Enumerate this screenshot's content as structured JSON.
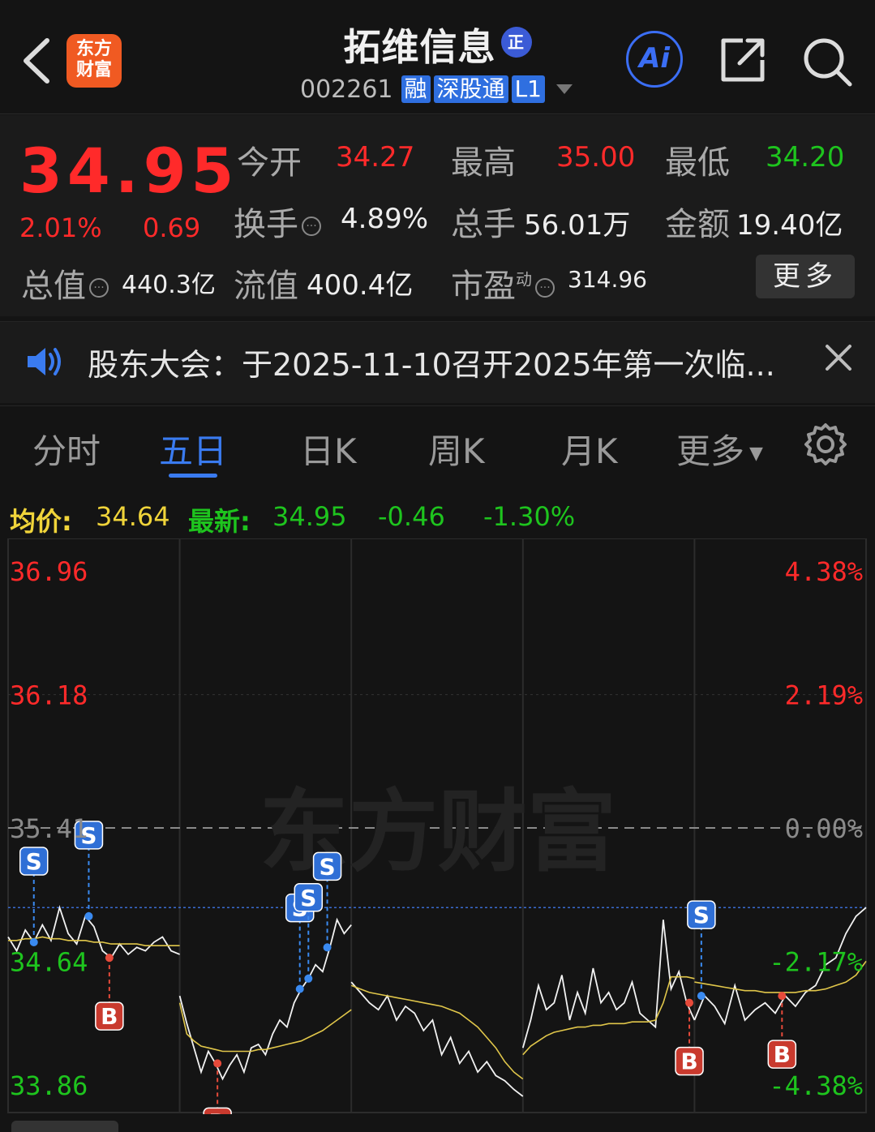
{
  "header": {
    "stock_name": "拓维信息",
    "zheng_badge": "正",
    "code": "002261",
    "tags": [
      "融",
      "深股通",
      "L1"
    ],
    "logo_text_line1": "东方",
    "logo_text_line2": "财富",
    "ai_label": "Ai"
  },
  "quote": {
    "price": "34.95",
    "change_pct": "2.01%",
    "change_amt": "0.69",
    "open_label": "今开",
    "open": "34.27",
    "high_label": "最高",
    "high": "35.00",
    "low_label": "最低",
    "low": "34.20",
    "turnover_label": "换手",
    "turnover": "4.89%",
    "volume_label": "总手",
    "volume": "56.01万",
    "amount_label": "金额",
    "amount": "19.40亿",
    "mktcap_label": "总值",
    "mktcap": "440.3亿",
    "float_label": "流值",
    "float_cap": "400.4亿",
    "pe_label": "市盈",
    "pe_sup": "动",
    "pe": "314.96",
    "more": "更多"
  },
  "notice": {
    "text": "股东大会：于2025-11-10召开2025年第一次临..."
  },
  "tabs": [
    "分时",
    "五日",
    "日K",
    "周K",
    "月K",
    "更多"
  ],
  "active_tab": 1,
  "infobar": {
    "avg_label": "均价:",
    "avg": "34.64",
    "latest_label": "最新:",
    "latest": "34.95",
    "chg": "-0.46",
    "chg_pct": "-1.30%"
  },
  "chart_data": {
    "type": "line",
    "days": 5,
    "y_left_ticks": [
      "36.96",
      "36.18",
      "35.41",
      "34.64",
      "33.86"
    ],
    "y_right_ticks": [
      "4.38%",
      "2.19%",
      "0.00%",
      "-2.17%",
      "-4.38%"
    ],
    "ylim": [
      33.86,
      36.96
    ],
    "base_price": 35.41,
    "watermark": "东方财富",
    "series": [
      {
        "values": [
          34.78,
          34.7,
          34.82,
          34.75,
          34.85,
          34.76,
          34.95,
          34.8,
          34.74,
          34.9,
          34.84,
          34.7,
          34.66,
          34.74,
          34.68,
          34.72,
          34.7,
          34.75,
          34.78,
          34.7,
          34.68,
          34.44,
          34.28,
          34.14,
          34.0,
          34.12,
          34.05,
          33.96,
          34.04,
          34.1,
          34.0,
          34.14,
          34.16,
          34.1,
          34.22,
          34.3,
          34.26,
          34.4,
          34.48,
          34.54,
          34.62,
          34.58,
          34.72,
          34.88,
          34.8,
          34.85,
          34.52,
          34.46,
          34.4,
          34.36,
          34.44,
          34.3,
          34.38,
          34.34,
          34.24,
          34.3,
          34.1,
          34.2,
          34.05,
          34.12,
          34.0,
          34.06,
          33.98,
          33.95,
          33.9,
          33.86,
          34.14,
          34.3,
          34.5,
          34.36,
          34.4,
          34.56,
          34.3,
          34.46,
          34.34,
          34.6,
          34.4,
          34.46,
          34.36,
          34.4,
          34.52,
          34.34,
          34.3,
          34.26,
          34.88,
          34.48,
          34.58,
          34.4,
          34.3,
          34.3,
          34.44,
          34.38,
          34.28,
          34.5,
          34.3,
          34.36,
          34.4,
          34.34,
          34.44,
          34.38,
          34.46,
          34.5,
          34.62,
          34.66,
          34.8,
          34.9,
          34.95
        ]
      },
      {
        "values": [
          34.76,
          34.76,
          34.77,
          34.77,
          34.78,
          34.77,
          34.77,
          34.76,
          34.76,
          34.76,
          34.75,
          34.75,
          34.74,
          34.74,
          34.74,
          34.74,
          34.73,
          34.73,
          34.73,
          34.73,
          34.73,
          34.4,
          34.22,
          34.18,
          34.15,
          34.14,
          34.13,
          34.12,
          34.12,
          34.12,
          34.12,
          34.12,
          34.13,
          34.13,
          34.14,
          34.15,
          34.16,
          34.17,
          34.18,
          34.2,
          34.22,
          34.24,
          34.27,
          34.3,
          34.33,
          34.36,
          34.5,
          34.48,
          34.46,
          34.45,
          34.44,
          34.43,
          34.42,
          34.41,
          34.4,
          34.39,
          34.38,
          34.36,
          34.34,
          34.3,
          34.26,
          34.2,
          34.14,
          34.06,
          34.0,
          33.96,
          34.1,
          34.15,
          34.18,
          34.21,
          34.23,
          34.24,
          34.25,
          34.26,
          34.26,
          34.27,
          34.27,
          34.28,
          34.28,
          34.28,
          34.29,
          34.29,
          34.29,
          34.3,
          34.4,
          34.55,
          34.55,
          34.55,
          34.54,
          34.52,
          34.51,
          34.5,
          34.49,
          34.48,
          34.47,
          34.47,
          34.46,
          34.46,
          34.46,
          34.46,
          34.47,
          34.47,
          34.48,
          34.5,
          34.52,
          34.56,
          34.64
        ]
      }
    ],
    "signals": [
      {
        "type": "S",
        "day": 1,
        "x": 0.15
      },
      {
        "type": "S",
        "day": 1,
        "x": 0.47
      },
      {
        "type": "B",
        "day": 1,
        "x": 0.59
      },
      {
        "type": "B",
        "day": 2,
        "x": 0.22
      },
      {
        "type": "S",
        "day": 2,
        "x": 0.7
      },
      {
        "type": "S",
        "day": 2,
        "x": 0.75
      },
      {
        "type": "S",
        "day": 2,
        "x": 0.86
      },
      {
        "type": "B",
        "day": 4,
        "x": 0.97
      },
      {
        "type": "S",
        "day": 5,
        "x": 0.04
      },
      {
        "type": "B",
        "day": 5,
        "x": 0.51
      }
    ]
  }
}
